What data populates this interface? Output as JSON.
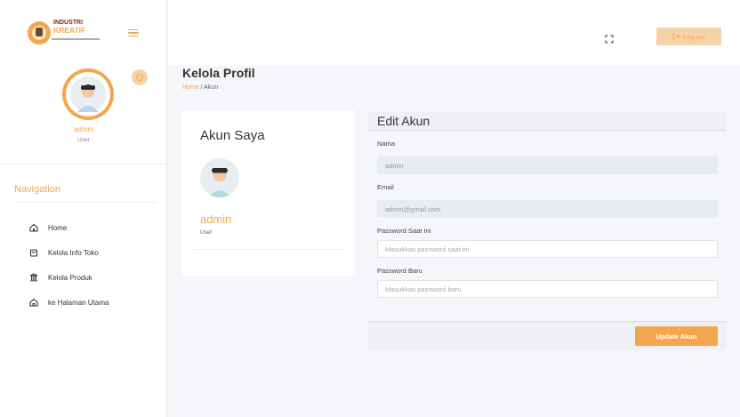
{
  "brand": {
    "logo_line1": "INDUSTRI",
    "logo_line2": "KREATIF"
  },
  "sidebar": {
    "profile": {
      "name": "admin",
      "role": "User"
    },
    "nav_title": "Navigation",
    "items": [
      {
        "label": "Home",
        "icon": "home-icon"
      },
      {
        "label": "Kelola Info Toko",
        "icon": "store-icon"
      },
      {
        "label": "Kelola Produk",
        "icon": "product-icon"
      },
      {
        "label": "ke Halaman Utama",
        "icon": "home-outline-icon"
      }
    ]
  },
  "topbar": {
    "logout_label": "Log out",
    "fullscreen_icon": "fullscreen-icon"
  },
  "page": {
    "title": "Kelola Profil",
    "breadcrumb": {
      "home": "Home",
      "separator": " / ",
      "current": "Akun"
    }
  },
  "account_card": {
    "title": "Akun Saya",
    "name": "admin",
    "role": "User"
  },
  "edit_form": {
    "title": "Edit Akun",
    "fields": {
      "nama": {
        "label": "Nama",
        "value": "admin"
      },
      "email": {
        "label": "Email",
        "value": "admin@gmail.com"
      },
      "current_password": {
        "label": "Password Saat Ini",
        "placeholder": "Masukkan password saat ini"
      },
      "new_password": {
        "label": "Password Baru",
        "placeholder": "Masukkan password baru"
      }
    },
    "submit_label": "Update Akun"
  },
  "colors": {
    "accent": "#f4a64f",
    "accent_light": "#f6d2a9",
    "background": "#f4f6f9"
  }
}
